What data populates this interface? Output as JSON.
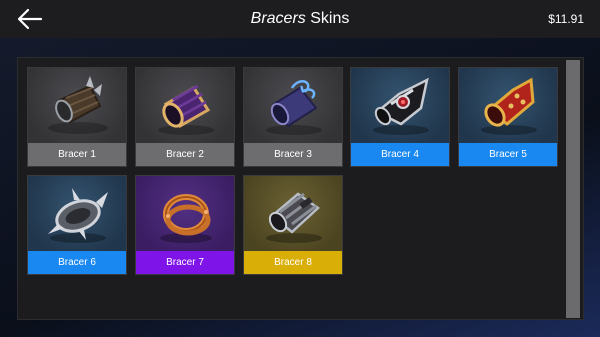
{
  "header": {
    "title_italic": "Bracers",
    "title_rest": " Skins",
    "balance": "$11.91"
  },
  "colors": {
    "common": "#6d6d70",
    "rare": "#1a88f1",
    "epic": "#7f14e8",
    "legendary": "#d9ae06"
  },
  "items": [
    {
      "label": "Bracer 1",
      "rarity": "common",
      "icon": "spiked-leather-bracer-icon"
    },
    {
      "label": "Bracer 2",
      "rarity": "common",
      "icon": "purple-gold-cuff-icon"
    },
    {
      "label": "Bracer 3",
      "rarity": "common",
      "icon": "swirl-blue-bracer-icon"
    },
    {
      "label": "Bracer 4",
      "rarity": "rare",
      "icon": "black-silver-gauntlet-icon"
    },
    {
      "label": "Bracer 5",
      "rarity": "rare",
      "icon": "red-gold-spiked-bracer-icon"
    },
    {
      "label": "Bracer 6",
      "rarity": "rare",
      "icon": "silver-spiked-ring-bracer-icon"
    },
    {
      "label": "Bracer 7",
      "rarity": "epic",
      "icon": "copper-ring-bracer-icon"
    },
    {
      "label": "Bracer 8",
      "rarity": "legendary",
      "icon": "steel-strapped-bracer-icon"
    }
  ]
}
